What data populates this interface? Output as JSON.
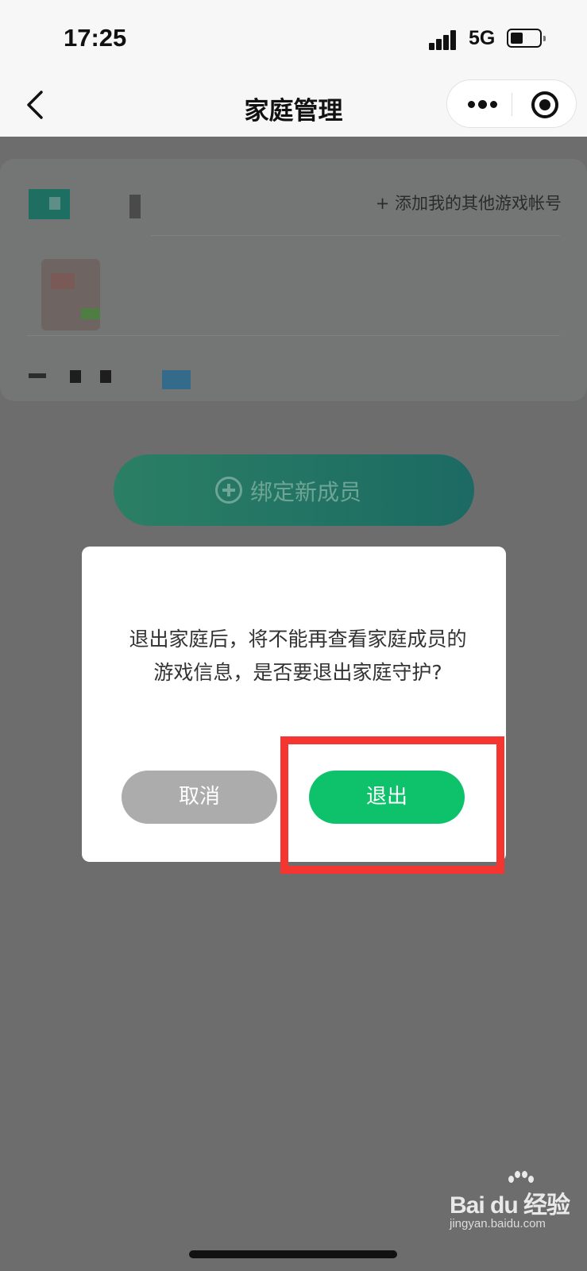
{
  "status_bar": {
    "time": "17:25",
    "network": "5G",
    "battery_level": 0.45
  },
  "nav": {
    "title": "家庭管理",
    "back_icon": "chevron-left-icon",
    "more_icon": "more-dots-icon",
    "close_icon": "target-icon"
  },
  "card": {
    "add_account_label": "+ 添加我的其他游戏帐号"
  },
  "bind_member": {
    "label": "绑定新成员",
    "icon": "plus-circle-icon"
  },
  "dialog": {
    "message": "退出家庭后，将不能再查看家庭成员的游戏信息，是否要退出家庭守护?",
    "cancel_label": "取消",
    "exit_label": "退出",
    "exit_color": "#0ec26c",
    "cancel_color": "#acacac",
    "highlight_color": "#f5352f"
  },
  "watermark": {
    "brand": "Bai du 经验",
    "url": "jingyan.baidu.com"
  }
}
